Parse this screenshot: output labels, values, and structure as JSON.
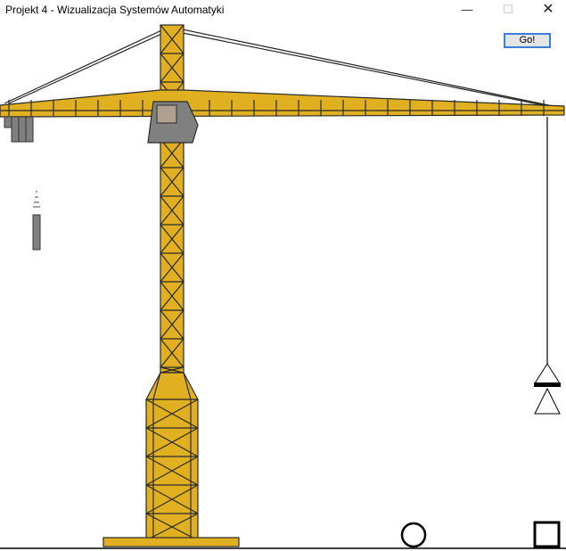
{
  "window": {
    "title": "Projekt 4 - Wizualizacja Systemów Automatyki",
    "controls": {
      "minimize": "—",
      "maximize": "☐",
      "close": "✕"
    }
  },
  "toolbar": {
    "go_label": "Go!"
  },
  "colors": {
    "crane_yellow": "#e0b020",
    "outline": "#2a2a2a",
    "cabin_gray": "#808080",
    "cabin_window": "#b0a090",
    "accent_button_border": "#3c7fd8"
  },
  "scene": {
    "objects": [
      "tower-crane",
      "hook-block",
      "circle-target",
      "square-target",
      "gray-block"
    ]
  }
}
